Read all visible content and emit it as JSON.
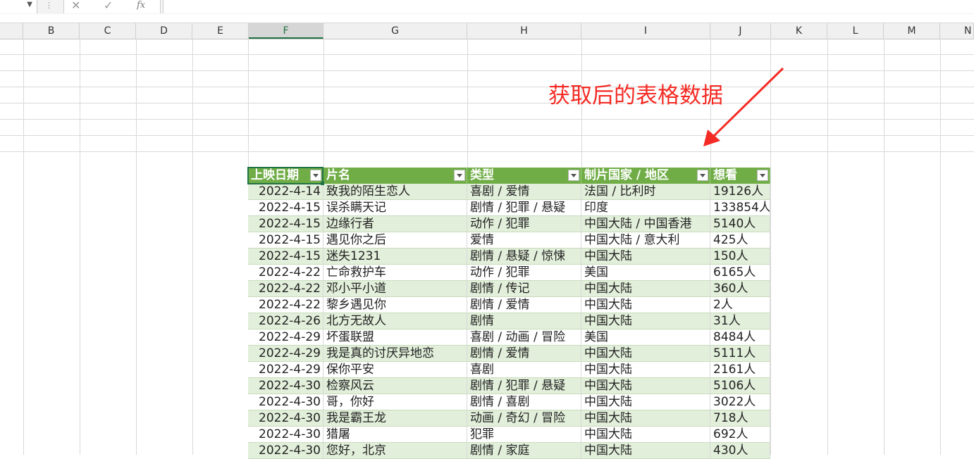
{
  "formula_bar": {
    "name_box_value": "",
    "cancel_glyph": "✕",
    "enter_glyph": "✓",
    "fx_label": "fx",
    "formula_value": ""
  },
  "columns": [
    "B",
    "C",
    "D",
    "E",
    "F",
    "G",
    "H",
    "I",
    "J",
    "K",
    "L",
    "M",
    "N"
  ],
  "selected_column": "F",
  "annotation": {
    "text": "获取后的表格数据",
    "color": "#f42b24"
  },
  "table": {
    "header_color": "#70ad47",
    "band_color": "#e2efda",
    "headers": [
      "上映日期",
      "片名",
      "类型",
      "制片国家 / 地区",
      "想看"
    ],
    "rows": [
      [
        "2022-4-14",
        "致我的陌生恋人",
        "喜剧 / 爱情",
        "法国 / 比利时",
        "19126人"
      ],
      [
        "2022-4-15",
        "误杀瞒天记",
        "剧情 / 犯罪 / 悬疑",
        "印度",
        "133854人"
      ],
      [
        "2022-4-15",
        "边缘行者",
        "动作 / 犯罪",
        "中国大陆 / 中国香港",
        "5140人"
      ],
      [
        "2022-4-15",
        "遇见你之后",
        "爱情",
        "中国大陆 / 意大利",
        "425人"
      ],
      [
        "2022-4-15",
        "迷失1231",
        "剧情 / 悬疑 / 惊悚",
        "中国大陆",
        "150人"
      ],
      [
        "2022-4-22",
        "亡命救护车",
        "动作 / 犯罪",
        "美国",
        "6165人"
      ],
      [
        "2022-4-22",
        "邓小平小道",
        "剧情 / 传记",
        "中国大陆",
        "360人"
      ],
      [
        "2022-4-22",
        "黎乡遇见你",
        "剧情 / 爱情",
        "中国大陆",
        "2人"
      ],
      [
        "2022-4-26",
        "北方无故人",
        "剧情",
        "中国大陆",
        "31人"
      ],
      [
        "2022-4-29",
        "坏蛋联盟",
        "喜剧 / 动画 / 冒险",
        "美国",
        "8484人"
      ],
      [
        "2022-4-29",
        "我是真的讨厌异地恋",
        "剧情 / 爱情",
        "中国大陆",
        "5111人"
      ],
      [
        "2022-4-29",
        "保你平安",
        "喜剧",
        "中国大陆",
        "2161人"
      ],
      [
        "2022-4-30",
        "检察风云",
        "剧情 / 犯罪 / 悬疑",
        "中国大陆",
        "5106人"
      ],
      [
        "2022-4-30",
        "哥，你好",
        "剧情 / 喜剧",
        "中国大陆",
        "3022人"
      ],
      [
        "2022-4-30",
        "我是霸王龙",
        "动画 / 奇幻 / 冒险",
        "中国大陆",
        "718人"
      ],
      [
        "2022-4-30",
        "猎屠",
        "犯罪",
        "中国大陆",
        "692人"
      ],
      [
        "2022-4-30",
        "您好，北京",
        "剧情 / 家庭",
        "中国大陆",
        "430人"
      ]
    ]
  }
}
